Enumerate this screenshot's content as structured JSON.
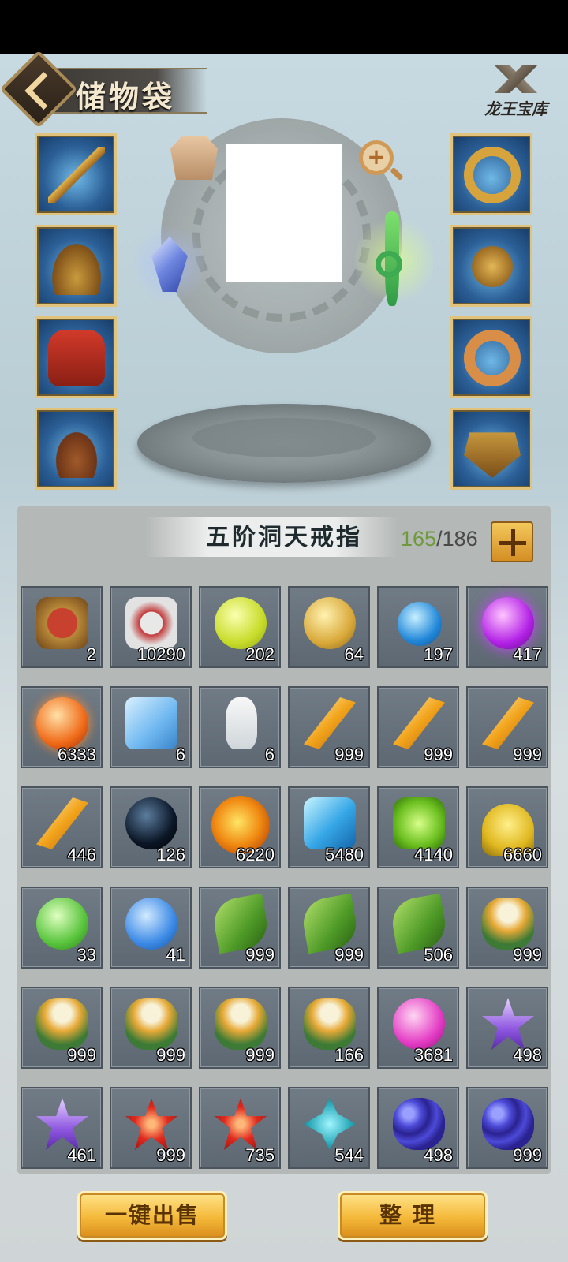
{
  "header": {
    "title": "储物袋",
    "treasury_label": "龙王宝库"
  },
  "equipment": {
    "left": [
      {
        "icon": "sword-icon"
      },
      {
        "icon": "helmet-icon"
      },
      {
        "icon": "armor-icon"
      },
      {
        "icon": "boots-icon"
      }
    ],
    "right": [
      {
        "icon": "ring-icon"
      },
      {
        "icon": "amulet-icon"
      },
      {
        "icon": "bracelet-icon"
      },
      {
        "icon": "belt-icon"
      }
    ]
  },
  "inventory": {
    "ring_name": "五阶洞天戒指",
    "used": "165",
    "capacity": "/186",
    "items": [
      {
        "icon": "token-shield-icon",
        "count": "2"
      },
      {
        "icon": "red-badge-icon",
        "count": "10290"
      },
      {
        "icon": "yellow-star-coin-icon",
        "count": "202"
      },
      {
        "icon": "gold-gourd-icon",
        "count": "64"
      },
      {
        "icon": "blue-orb-icon",
        "count": "197"
      },
      {
        "icon": "purple-orb-icon",
        "count": "417"
      },
      {
        "icon": "orange-orb-icon",
        "count": "6333"
      },
      {
        "icon": "gift-box-icon",
        "count": "6"
      },
      {
        "icon": "porcelain-vase-icon",
        "count": "6"
      },
      {
        "icon": "amber-crystal-icon",
        "count": "999"
      },
      {
        "icon": "amber-crystal-icon",
        "count": "999"
      },
      {
        "icon": "amber-crystal-icon",
        "count": "999"
      },
      {
        "icon": "amber-crystal-icon",
        "count": "446"
      },
      {
        "icon": "black-pearl-icon",
        "count": "126"
      },
      {
        "icon": "fire-orb-icon",
        "count": "6220"
      },
      {
        "icon": "ice-rock-icon",
        "count": "5480"
      },
      {
        "icon": "green-gem-icon",
        "count": "4140"
      },
      {
        "icon": "gold-dust-icon",
        "count": "6660"
      },
      {
        "icon": "green-scroll-orb-icon",
        "count": "33"
      },
      {
        "icon": "blue-scroll-orb-icon",
        "count": "41"
      },
      {
        "icon": "herb-leaf-icon",
        "count": "999"
      },
      {
        "icon": "herb-leaf-icon",
        "count": "999"
      },
      {
        "icon": "herb-leaf-icon",
        "count": "506"
      },
      {
        "icon": "spider-lily-icon",
        "count": "999"
      },
      {
        "icon": "spider-lily-icon",
        "count": "999"
      },
      {
        "icon": "spider-lily-icon",
        "count": "999"
      },
      {
        "icon": "spider-lily-icon",
        "count": "999"
      },
      {
        "icon": "spider-lily-icon",
        "count": "166"
      },
      {
        "icon": "pink-fruit-icon",
        "count": "3681"
      },
      {
        "icon": "purple-flower-icon",
        "count": "498"
      },
      {
        "icon": "purple-flower-icon",
        "count": "461"
      },
      {
        "icon": "red-lotus-icon",
        "count": "999"
      },
      {
        "icon": "red-lotus-icon",
        "count": "735"
      },
      {
        "icon": "teal-flower-icon",
        "count": "544"
      },
      {
        "icon": "grapes-icon",
        "count": "498"
      },
      {
        "icon": "grapes-icon",
        "count": "999"
      }
    ]
  },
  "actions": {
    "sell_all": "一键出售",
    "sort": "整理"
  }
}
